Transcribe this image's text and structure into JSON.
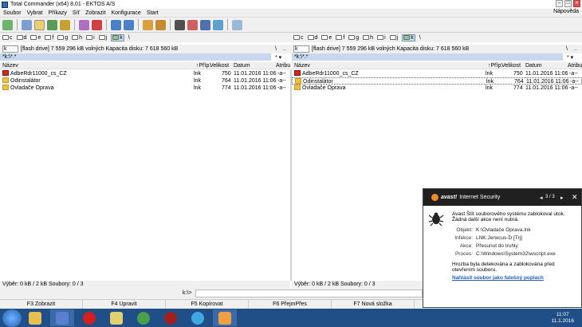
{
  "window": {
    "title": "Total Commander (x64) 8.01 - EKTOS A/S",
    "controls": [
      "–",
      "□",
      "✕"
    ]
  },
  "menu": {
    "items": [
      "Soubor",
      "Vybrat",
      "Příkazy",
      "Síť",
      "Zobrazit",
      "Konfigurace",
      "Start"
    ],
    "help": "Nápověda"
  },
  "drives": {
    "letters": [
      "c",
      "d",
      "e",
      "f",
      "g",
      "h",
      "i",
      "j",
      "k"
    ],
    "extra": "\\"
  },
  "left": {
    "drive_label": "k",
    "drive_info": "[flash drive]  7 559 296 kB volných  Kapacita disku: 7 618 560 kB",
    "path": "*k:\\*.*",
    "back": "\\",
    "dots": "..",
    "sort_arrows": "* ▾",
    "columns": {
      "name": "Název",
      "ext": "↑Příp.",
      "size": "Velikost",
      "date": "Datum",
      "attr": "Atribu"
    },
    "files": [
      {
        "name": "AdbeRdr11000_cs_CZ",
        "ext": "lnk",
        "size": "750",
        "date": "11.01.2016 11:06",
        "attr": "-a--",
        "icon": "pdf-icon"
      },
      {
        "name": "Odinstalátor",
        "ext": "lnk",
        "size": "764",
        "date": "11.01.2016 11:06",
        "attr": "-a--",
        "icon": "folder-icon"
      },
      {
        "name": "Ovladače Oprava",
        "ext": "lnk",
        "size": "774",
        "date": "11.01.2016 11:06",
        "attr": "-a--",
        "icon": "folder-icon"
      }
    ],
    "status": "Výběr: 0 kB / 2 kB  Soubory: 0 / 3"
  },
  "right": {
    "drive_label": "k",
    "drive_info": "[flash drive]  7 559 296 kB volných  Kapacita disku: 7 618 560 kB",
    "path": "*k:\\*.*",
    "back": "\\",
    "dots": "..",
    "sort_arrows": "* ▾",
    "columns": {
      "name": "Název",
      "ext": "↑Příp.",
      "size": "Velikost",
      "date": "Datum",
      "attr": "Atribu"
    },
    "files": [
      {
        "name": "AdbeRdr11000_cs_CZ",
        "ext": "lnk",
        "size": "750",
        "date": "11.01.2016 11:06",
        "attr": "-a--",
        "icon": "pdf-icon"
      },
      {
        "name": "Odinstalátor",
        "ext": "lnk",
        "size": "764",
        "date": "11.01.2016 11:06",
        "attr": "-a--",
        "icon": "folder-icon"
      },
      {
        "name": "Ovladače Oprava",
        "ext": "lnk",
        "size": "774",
        "date": "11.01.2016 11:06",
        "attr": "-a--",
        "icon": "folder-icon"
      }
    ],
    "status": "Výběr: 0 kB / 2 kB  Soubory: 0 / 3"
  },
  "cmdline": {
    "prompt": "k:\\>"
  },
  "fkeys": [
    "F3 Zobrazit",
    "F4 Upravit",
    "F5 Kopírovat",
    "F6 PřejmPřes",
    "F7 Nová složka"
  ],
  "avast": {
    "brand": "avast!",
    "product": "Internet Security",
    "counter": "3 / 3",
    "nav_prev": "◂",
    "nav_next": "▸",
    "close": "✕",
    "message": "Avast Štít souborového systému zablokoval útok. Žádná další akce není nutná.",
    "details": [
      {
        "key": "Objekt:",
        "value": "K:\\Ovladače Oprava.lnk"
      },
      {
        "key": "Infekce:",
        "value": "LNK:Jenxcus-D [Trj]"
      },
      {
        "key": "Akce:",
        "value": "Přesunut do truhly"
      },
      {
        "key": "Proces:",
        "value": "C:\\Windows\\System32\\wscript.exe"
      }
    ],
    "footer": "Hrozba byla detekována a zablokována před otevřením souboru.",
    "link": "Nahlásit soubor jako falešný poplach"
  },
  "taskbar": {
    "apps": [
      "folder-icon",
      "save-icon",
      "opera-icon",
      "notes-icon",
      "utorrent-icon",
      "media-icon",
      "ccleaner-icon",
      "totalcmd-icon"
    ],
    "time": "11:07",
    "date": "11.1.2016",
    "colors": {
      "bar": "#1f4f86",
      "start": "#2a7ad8"
    }
  },
  "colors": {
    "path_highlight": "#c9d8f0",
    "selected_row": "#ffffff",
    "folder": "#f0c040",
    "pdf": "#d42a1e",
    "avast_header": "#202020",
    "avast_orange": "#f08a24"
  }
}
